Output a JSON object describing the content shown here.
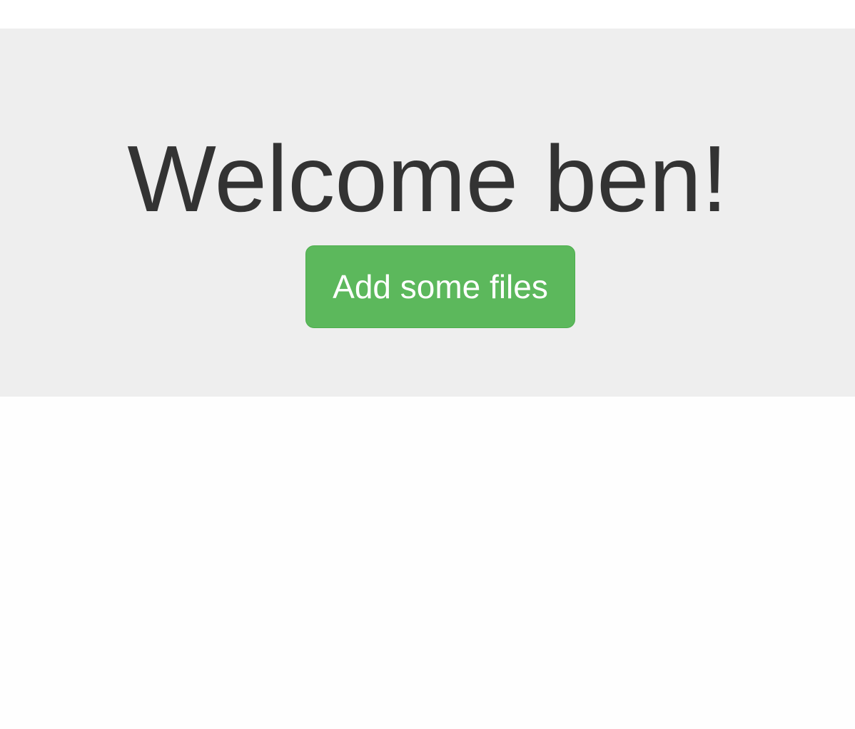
{
  "hero": {
    "title": "Welcome ben!",
    "button_label": "Add some files"
  },
  "colors": {
    "hero_background": "#eeeeee",
    "title_text": "#333333",
    "button_background": "#5cb85c",
    "button_border": "#4cae4c",
    "button_text": "#ffffff"
  }
}
